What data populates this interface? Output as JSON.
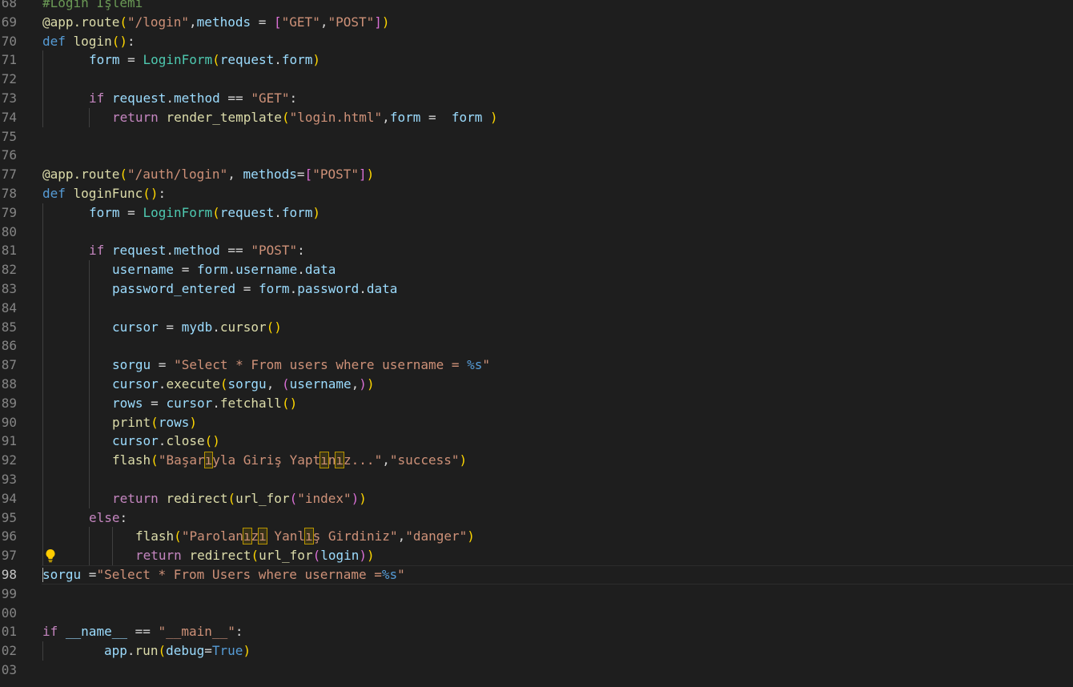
{
  "editor": {
    "language": "python",
    "current_line": 98,
    "lightbulb_line": 97,
    "lightbulb_icon": "lightbulb-icon",
    "lines": [
      {
        "n": "68",
        "indent": 0,
        "tokens": [
          [
            "c-com",
            "#Login İşlemi"
          ]
        ]
      },
      {
        "n": "69",
        "indent": 0,
        "tokens": [
          [
            "c-fn",
            "@app.route"
          ],
          [
            "c-b1",
            "("
          ],
          [
            "c-str",
            "\"/login\""
          ],
          [
            "c-pun",
            ","
          ],
          [
            "c-var",
            "methods"
          ],
          [
            "c-op",
            " = "
          ],
          [
            "c-b2",
            "["
          ],
          [
            "c-str",
            "\"GET\""
          ],
          [
            "c-pun",
            ","
          ],
          [
            "c-str",
            "\"POST\""
          ],
          [
            "c-b2",
            "]"
          ],
          [
            "c-b1",
            ")"
          ]
        ]
      },
      {
        "n": "70",
        "indent": 0,
        "tokens": [
          [
            "c-kw",
            "def "
          ],
          [
            "c-fn",
            "login"
          ],
          [
            "c-b1",
            "()"
          ],
          [
            "c-pun",
            ":"
          ]
        ]
      },
      {
        "n": "71",
        "indent": 1,
        "tokens": [
          [
            "c-var",
            "form"
          ],
          [
            "c-op",
            " = "
          ],
          [
            "c-cls",
            "LoginForm"
          ],
          [
            "c-b1",
            "("
          ],
          [
            "c-var",
            "request"
          ],
          [
            "c-pun",
            "."
          ],
          [
            "c-var",
            "form"
          ],
          [
            "c-b1",
            ")"
          ]
        ]
      },
      {
        "n": "72",
        "indent": 1,
        "tokens": []
      },
      {
        "n": "73",
        "indent": 1,
        "tokens": [
          [
            "c-ctl",
            "if "
          ],
          [
            "c-var",
            "request"
          ],
          [
            "c-pun",
            "."
          ],
          [
            "c-var",
            "method"
          ],
          [
            "c-op",
            " == "
          ],
          [
            "c-str",
            "\"GET\""
          ],
          [
            "c-pun",
            ":"
          ]
        ]
      },
      {
        "n": "74",
        "indent": 2,
        "tokens": [
          [
            "c-ctl",
            "return "
          ],
          [
            "c-fn",
            "render_template"
          ],
          [
            "c-b1",
            "("
          ],
          [
            "c-str",
            "\"login.html\""
          ],
          [
            "c-pun",
            ","
          ],
          [
            "c-var",
            "form"
          ],
          [
            "c-op",
            " =  "
          ],
          [
            "c-var",
            "form"
          ],
          [
            "c-pun",
            " "
          ],
          [
            "c-b1",
            ")"
          ]
        ]
      },
      {
        "n": "75",
        "indent": 0,
        "tokens": []
      },
      {
        "n": "76",
        "indent": 0,
        "tokens": []
      },
      {
        "n": "77",
        "indent": 0,
        "tokens": [
          [
            "c-fn",
            "@app.route"
          ],
          [
            "c-b1",
            "("
          ],
          [
            "c-str",
            "\"/auth/login\""
          ],
          [
            "c-pun",
            ", "
          ],
          [
            "c-var",
            "methods"
          ],
          [
            "c-op",
            "="
          ],
          [
            "c-b2",
            "["
          ],
          [
            "c-str",
            "\"POST\""
          ],
          [
            "c-b2",
            "]"
          ],
          [
            "c-b1",
            ")"
          ]
        ]
      },
      {
        "n": "78",
        "indent": 0,
        "tokens": [
          [
            "c-kw",
            "def "
          ],
          [
            "c-fn",
            "loginFunc"
          ],
          [
            "c-b1",
            "()"
          ],
          [
            "c-pun",
            ":"
          ]
        ]
      },
      {
        "n": "79",
        "indent": 1,
        "tokens": [
          [
            "c-var",
            "form"
          ],
          [
            "c-op",
            " = "
          ],
          [
            "c-cls",
            "LoginForm"
          ],
          [
            "c-b1",
            "("
          ],
          [
            "c-var",
            "request"
          ],
          [
            "c-pun",
            "."
          ],
          [
            "c-var",
            "form"
          ],
          [
            "c-b1",
            ")"
          ]
        ]
      },
      {
        "n": "80",
        "indent": 1,
        "tokens": []
      },
      {
        "n": "81",
        "indent": 1,
        "tokens": [
          [
            "c-ctl",
            "if "
          ],
          [
            "c-var",
            "request"
          ],
          [
            "c-pun",
            "."
          ],
          [
            "c-var",
            "method"
          ],
          [
            "c-op",
            " == "
          ],
          [
            "c-str",
            "\"POST\""
          ],
          [
            "c-pun",
            ":"
          ]
        ]
      },
      {
        "n": "82",
        "indent": 2,
        "tokens": [
          [
            "c-var",
            "username"
          ],
          [
            "c-op",
            " = "
          ],
          [
            "c-var",
            "form"
          ],
          [
            "c-pun",
            "."
          ],
          [
            "c-var",
            "username"
          ],
          [
            "c-pun",
            "."
          ],
          [
            "c-var",
            "data"
          ]
        ]
      },
      {
        "n": "83",
        "indent": 2,
        "tokens": [
          [
            "c-var",
            "password_entered"
          ],
          [
            "c-op",
            " = "
          ],
          [
            "c-var",
            "form"
          ],
          [
            "c-pun",
            "."
          ],
          [
            "c-var",
            "password"
          ],
          [
            "c-pun",
            "."
          ],
          [
            "c-var",
            "data"
          ]
        ]
      },
      {
        "n": "84",
        "indent": 2,
        "tokens": []
      },
      {
        "n": "85",
        "indent": 2,
        "tokens": [
          [
            "c-var",
            "cursor"
          ],
          [
            "c-op",
            " = "
          ],
          [
            "c-var",
            "mydb"
          ],
          [
            "c-pun",
            "."
          ],
          [
            "c-fn",
            "cursor"
          ],
          [
            "c-b1",
            "()"
          ]
        ]
      },
      {
        "n": "86",
        "indent": 2,
        "tokens": []
      },
      {
        "n": "87",
        "indent": 2,
        "tokens": [
          [
            "c-var",
            "sorgu"
          ],
          [
            "c-op",
            " = "
          ],
          [
            "c-str",
            "\"Select * From users where username = "
          ],
          [
            "c-esc",
            "%s"
          ],
          [
            "c-str",
            "\""
          ]
        ]
      },
      {
        "n": "88",
        "indent": 2,
        "tokens": [
          [
            "c-var",
            "cursor"
          ],
          [
            "c-pun",
            "."
          ],
          [
            "c-fn",
            "execute"
          ],
          [
            "c-b1",
            "("
          ],
          [
            "c-var",
            "sorgu"
          ],
          [
            "c-pun",
            ", "
          ],
          [
            "c-b2",
            "("
          ],
          [
            "c-var",
            "username"
          ],
          [
            "c-pun",
            ","
          ],
          [
            "c-b2",
            ")"
          ],
          [
            "c-b1",
            ")"
          ]
        ]
      },
      {
        "n": "89",
        "indent": 2,
        "tokens": [
          [
            "c-var",
            "rows"
          ],
          [
            "c-op",
            " = "
          ],
          [
            "c-var",
            "cursor"
          ],
          [
            "c-pun",
            "."
          ],
          [
            "c-fn",
            "fetchall"
          ],
          [
            "c-b1",
            "()"
          ]
        ]
      },
      {
        "n": "90",
        "indent": 2,
        "tokens": [
          [
            "c-fn",
            "print"
          ],
          [
            "c-b1",
            "("
          ],
          [
            "c-var",
            "rows"
          ],
          [
            "c-b1",
            ")"
          ]
        ]
      },
      {
        "n": "91",
        "indent": 2,
        "tokens": [
          [
            "c-var",
            "cursor"
          ],
          [
            "c-pun",
            "."
          ],
          [
            "c-fn",
            "close"
          ],
          [
            "c-b1",
            "()"
          ]
        ]
      },
      {
        "n": "92",
        "indent": 2,
        "tokens": [
          [
            "c-fn",
            "flash"
          ],
          [
            "c-b1",
            "("
          ],
          [
            "c-str",
            "\"Başar"
          ],
          [
            "c-str c-uni",
            "ı"
          ],
          [
            "c-str",
            "yla Giriş Yapt"
          ],
          [
            "c-str c-uni",
            "ı"
          ],
          [
            "c-str",
            "n"
          ],
          [
            "c-str c-uni",
            "ı"
          ],
          [
            "c-str",
            "z...\""
          ],
          [
            "c-pun",
            ","
          ],
          [
            "c-str",
            "\"success\""
          ],
          [
            "c-b1",
            ")"
          ]
        ]
      },
      {
        "n": "93",
        "indent": 2,
        "tokens": []
      },
      {
        "n": "94",
        "indent": 2,
        "tokens": [
          [
            "c-ctl",
            "return "
          ],
          [
            "c-fn",
            "redirect"
          ],
          [
            "c-b1",
            "("
          ],
          [
            "c-fn",
            "url_for"
          ],
          [
            "c-b2",
            "("
          ],
          [
            "c-str",
            "\"index\""
          ],
          [
            "c-b2",
            ")"
          ],
          [
            "c-b1",
            ")"
          ]
        ]
      },
      {
        "n": "95",
        "indent": 1,
        "tokens": [
          [
            "c-ctl",
            "else"
          ],
          [
            "c-pun",
            ":"
          ]
        ]
      },
      {
        "n": "96",
        "indent": 2,
        "extra": true,
        "tokens": [
          [
            "c-fn",
            "flash"
          ],
          [
            "c-b1",
            "("
          ],
          [
            "c-str",
            "\"Parolan"
          ],
          [
            "c-str c-uni",
            "ı"
          ],
          [
            "c-str",
            "z"
          ],
          [
            "c-str c-uni",
            "ı"
          ],
          [
            "c-str",
            " Yanl"
          ],
          [
            "c-str c-uni",
            "ı"
          ],
          [
            "c-str",
            "ş Girdiniz\""
          ],
          [
            "c-pun",
            ","
          ],
          [
            "c-str",
            "\"danger\""
          ],
          [
            "c-b1",
            ")"
          ]
        ]
      },
      {
        "n": "97",
        "indent": 2,
        "extra": true,
        "tokens": [
          [
            "c-ctl",
            "return "
          ],
          [
            "c-fn",
            "redirect"
          ],
          [
            "c-b1",
            "("
          ],
          [
            "c-fn",
            "url_for"
          ],
          [
            "c-b2",
            "("
          ],
          [
            "c-var",
            "login"
          ],
          [
            "c-b2",
            ")"
          ],
          [
            "c-b1",
            ")"
          ]
        ]
      },
      {
        "n": "98",
        "indent": 0,
        "tokens": [
          [
            "c-var",
            "sorgu"
          ],
          [
            "c-op",
            " ="
          ],
          [
            "c-str",
            "\"Select * From Users where username ="
          ],
          [
            "c-esc",
            "%s"
          ],
          [
            "c-str",
            "\""
          ]
        ]
      },
      {
        "n": "99",
        "indent": 0,
        "tokens": []
      },
      {
        "n": "00",
        "indent": 0,
        "tokens": []
      },
      {
        "n": "01",
        "indent": 0,
        "tokens": [
          [
            "c-ctl",
            "if "
          ],
          [
            "c-var",
            "__name__"
          ],
          [
            "c-op",
            " == "
          ],
          [
            "c-str",
            "\"__main__\""
          ],
          [
            "c-pun",
            ":"
          ]
        ]
      },
      {
        "n": "02",
        "indent": 1,
        "wide": true,
        "tokens": [
          [
            "c-var",
            "app"
          ],
          [
            "c-pun",
            "."
          ],
          [
            "c-fn",
            "run"
          ],
          [
            "c-b1",
            "("
          ],
          [
            "c-var",
            "debug"
          ],
          [
            "c-op",
            "="
          ],
          [
            "c-kw",
            "True"
          ],
          [
            "c-b1",
            ")"
          ]
        ]
      },
      {
        "n": "03",
        "indent": 0,
        "tokens": []
      }
    ]
  }
}
